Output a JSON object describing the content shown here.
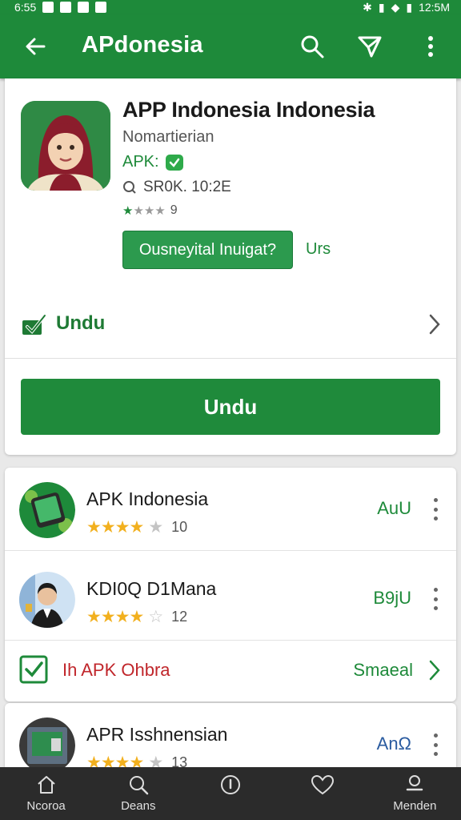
{
  "status_bar": {
    "time": "6:55",
    "right_time": "12:5M"
  },
  "app_bar": {
    "title": "APdonesia",
    "back_icon": "arrow-left-icon",
    "actions": [
      "search-icon",
      "send-icon",
      "more-vert-icon"
    ]
  },
  "app_detail": {
    "title": "APP Indonesia Indonesia",
    "developer": "Nomartierian",
    "apk_label": "APK:",
    "size": "SR0K. 10:2E",
    "rating_count": "9",
    "rating_stars": 1,
    "promo_button": "Ousneyital Inuigat?",
    "promo_side": "Urs",
    "undu_label": "Undu",
    "download_button": "Undu"
  },
  "list": {
    "items": [
      {
        "title": "APK Indonesia",
        "stars": 4,
        "count": "10",
        "action": "AuU",
        "action_color": "#1e8a3a"
      },
      {
        "title": "KDI0Q D1Mana",
        "stars": 4,
        "count": "12",
        "action": "B9jU",
        "action_color": "#1e8a3a"
      }
    ],
    "promo": {
      "text": "Ih APK Ohbra",
      "action": "Smaeal"
    },
    "partial": {
      "title": "APR Isshnensian",
      "stars": 4,
      "count": "13",
      "action": "AnΩ"
    }
  },
  "bottom_nav": [
    {
      "label": "Ncoroa",
      "icon": "home-icon"
    },
    {
      "label": "Deans",
      "icon": "search-icon"
    },
    {
      "label": "",
      "icon": "info-icon"
    },
    {
      "label": "",
      "icon": "heart-icon"
    },
    {
      "label": "Menden",
      "icon": "profile-icon"
    }
  ],
  "colors": {
    "primary": "#1e8a3a",
    "star": "#f2b01e",
    "promo_red": "#c0262b",
    "nav_bg": "#2b2b2b"
  }
}
